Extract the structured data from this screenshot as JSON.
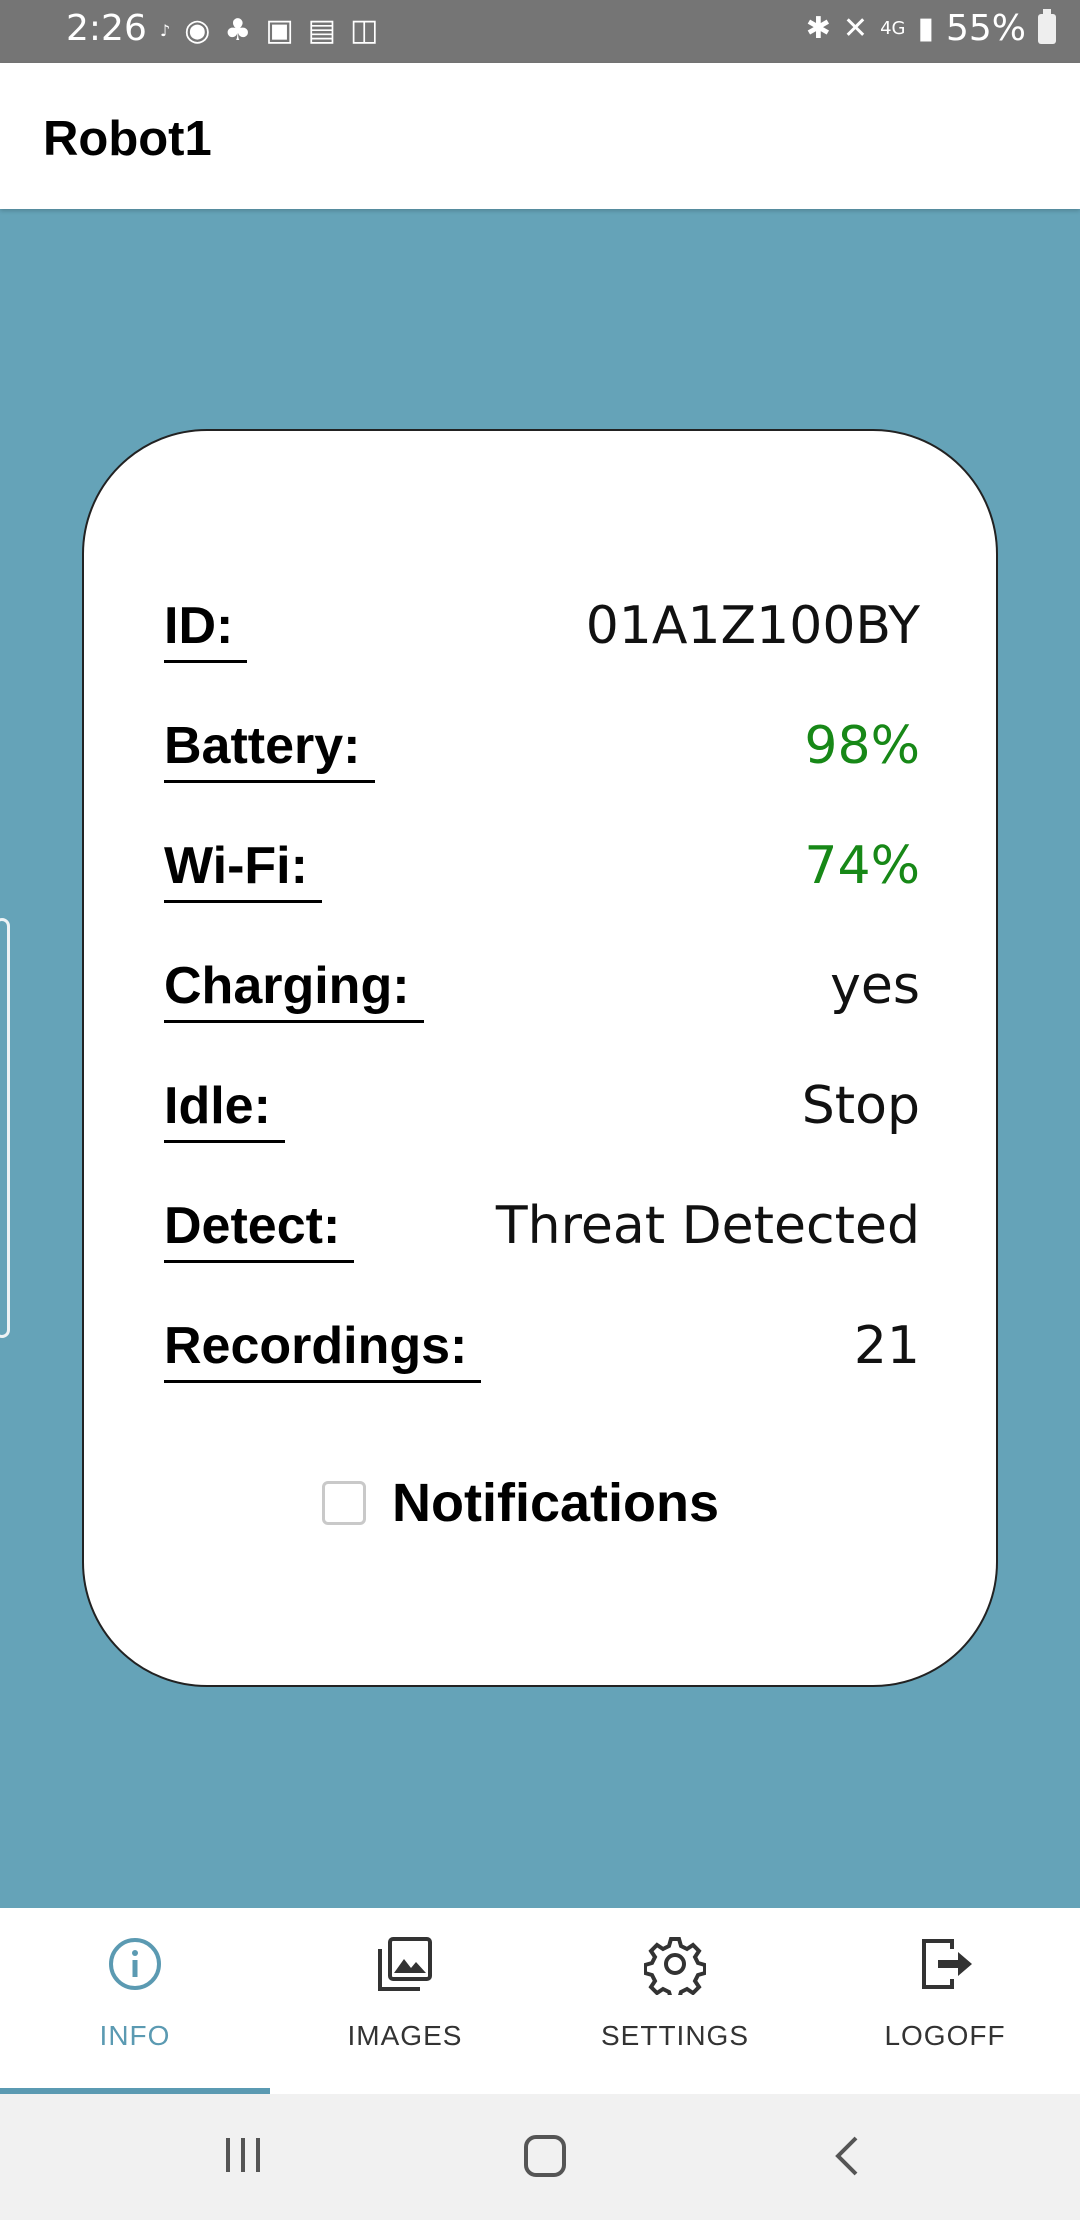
{
  "status_bar": {
    "time": "2:26",
    "left_icons": [
      "amazon-music-icon",
      "messenger-icon",
      "app-icon",
      "gallery-icon",
      "wifi-calling-icon",
      "translate-icon"
    ],
    "right_icons": [
      "bluetooth-icon",
      "mute-icon",
      "lte-icon",
      "signal-icon"
    ],
    "battery_percent": "55%"
  },
  "app_bar": {
    "title": "Robot1"
  },
  "info": {
    "rows": [
      {
        "label": "ID:",
        "value": "01A1Z100BY"
      },
      {
        "label": "Battery:",
        "value": "98%"
      },
      {
        "label": "Wi-Fi:",
        "value": "74%"
      },
      {
        "label": "Charging:",
        "value": "yes"
      },
      {
        "label": "Idle:",
        "value": "Stop"
      },
      {
        "label": "Detect:",
        "value": "Threat Detected"
      },
      {
        "label": "Recordings:",
        "value": "21"
      }
    ],
    "good_color": "#178817"
  },
  "notifications": {
    "label": "Notifications",
    "checked": false
  },
  "nav": {
    "tabs": [
      {
        "label": "INFO",
        "icon": "info-icon",
        "active": true
      },
      {
        "label": "IMAGES",
        "icon": "images-icon",
        "active": false
      },
      {
        "label": "SETTINGS",
        "icon": "gear-icon",
        "active": false
      },
      {
        "label": "LOGOFF",
        "icon": "logoff-icon",
        "active": false
      }
    ],
    "accent": "#5b9ab2"
  }
}
